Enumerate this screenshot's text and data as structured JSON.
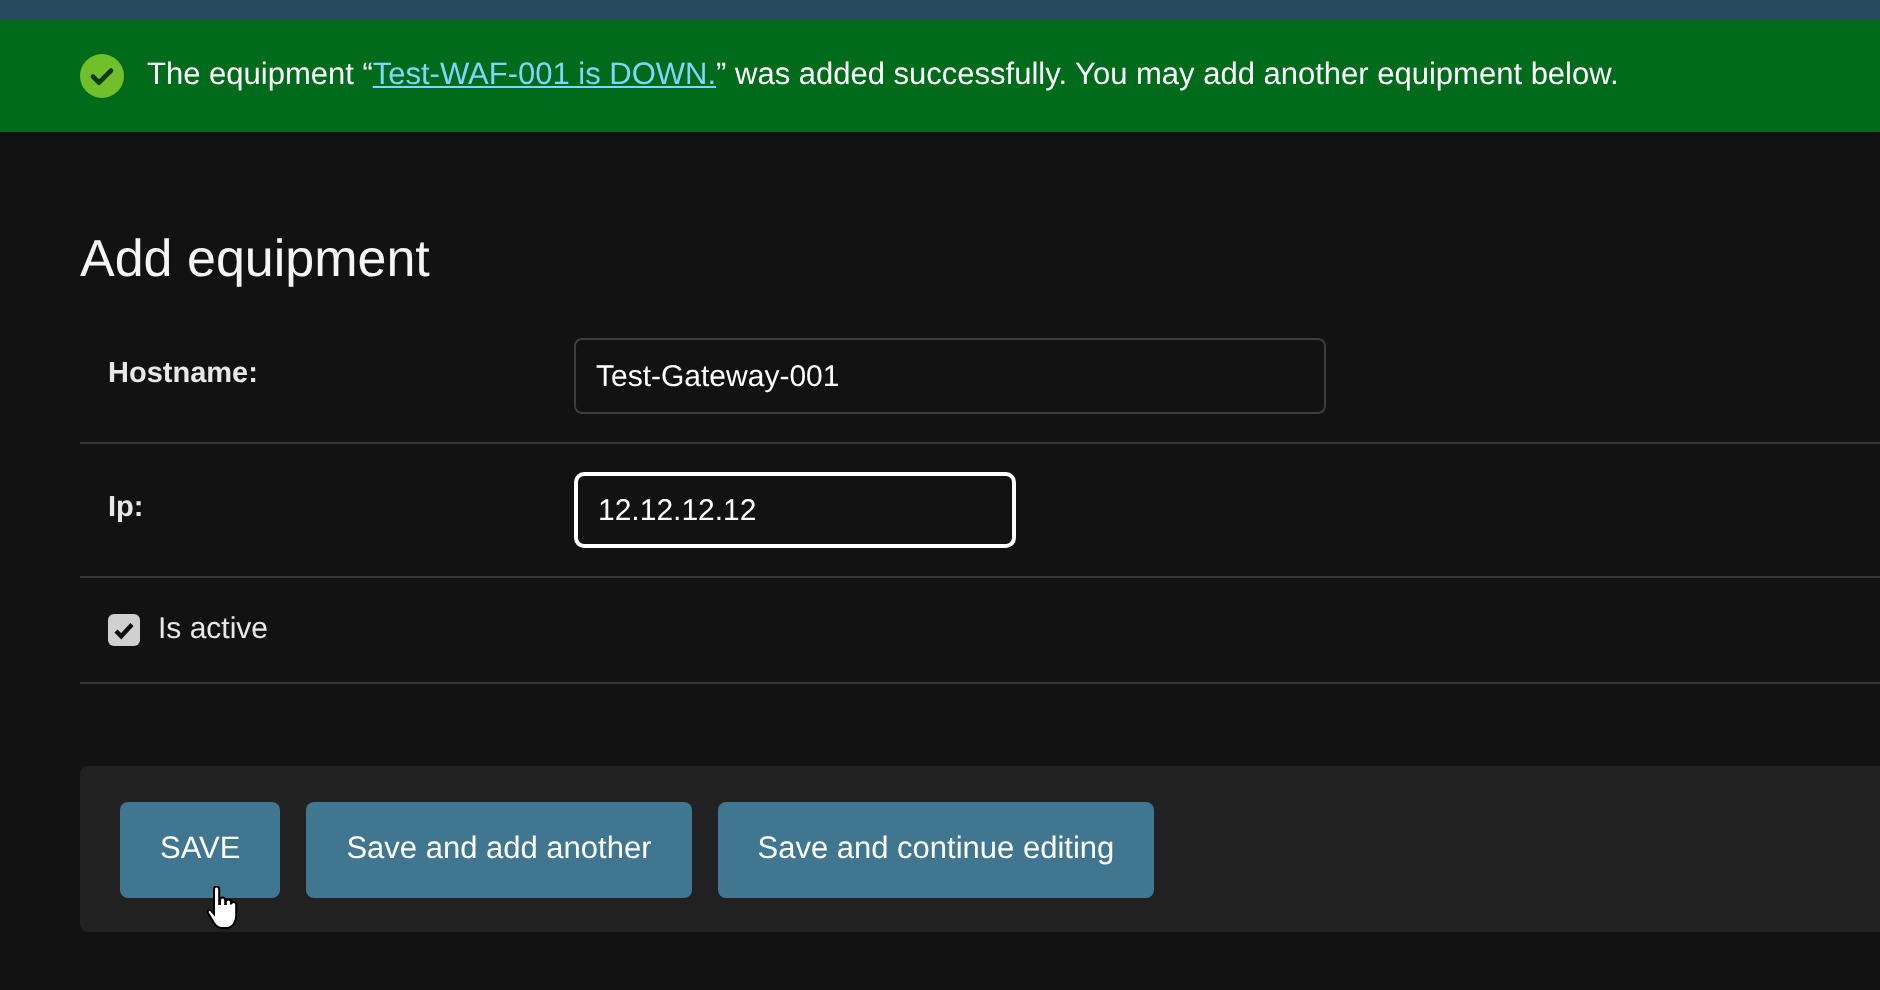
{
  "message": {
    "before": "The equipment “",
    "link": "Test-WAF-001 is DOWN.",
    "after": "” was added successfully. You may add another equipment below."
  },
  "title": "Add equipment",
  "fields": [
    {
      "kind": "text",
      "label": "Hostname:",
      "value": "Test-Gateway-001",
      "focused": false
    },
    {
      "kind": "ip",
      "label": "Ip:",
      "value": "12.12.12.12",
      "focused": true
    },
    {
      "kind": "checkbox",
      "label": "Is active",
      "checked": true
    }
  ],
  "buttons": [
    {
      "label": "SAVE"
    },
    {
      "label": "Save and add another"
    },
    {
      "label": "Save and continue editing"
    }
  ]
}
